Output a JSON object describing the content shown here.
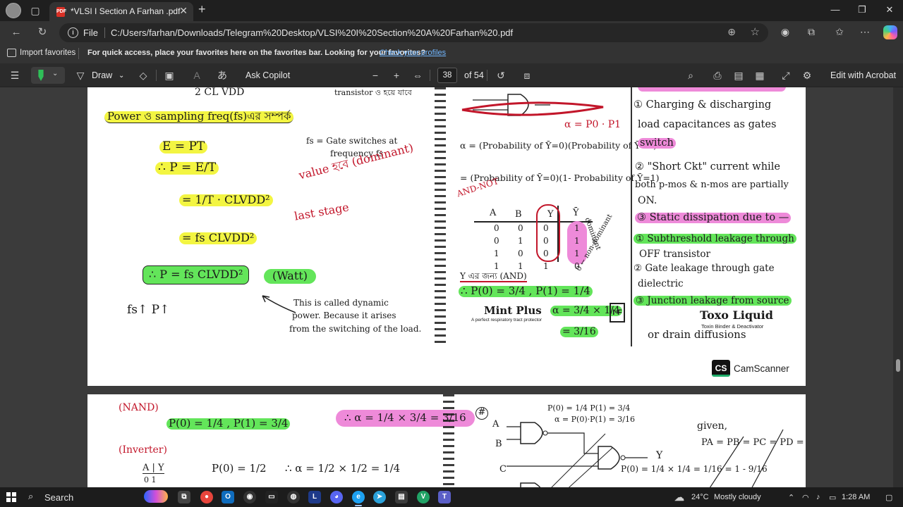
{
  "browser": {
    "tab_title": "*VLSI I Section A Farhan .pdf",
    "file_label": "File",
    "url": "C:/Users/farhan/Downloads/Telegram%20Desktop/VLSI%20I%20Section%20A%20Farhan%20.pdf"
  },
  "favorites_bar": {
    "import_label": "Import favorites",
    "message": "For quick access, place your favorites here on the favorites bar. Looking for your favorites?",
    "link": "Check your profiles"
  },
  "pdf_toolbar": {
    "draw_label": "Draw",
    "ask_copilot_label": "Ask Copilot",
    "current_page": "38",
    "total_pages": "of 54",
    "edit_acrobat_label": "Edit with Acrobat"
  },
  "page1": {
    "left": {
      "cvdd_top": "2 CL VDD",
      "transistor_note": "transistor ও হয়ে যাবে",
      "heading": "Power ও sampling freq(fs)এর সম্পর্ক",
      "eq1": "E = PT",
      "eq2": "∴ P = E/T",
      "eq3": "= 1/T · CLVDD²",
      "eq4": "= fs CLVDD²",
      "eq5": "∴ P = fs CLVDD²",
      "unit": "(Watt)",
      "relation": "fs↑   P↑",
      "fs_note_1": "fs = Gate switches at",
      "fs_note_2": "frequency  fs",
      "value_note": "value হবে (dominant)",
      "last_stage": "last stage",
      "dynamic_1": "This is called dynamic",
      "dynamic_2": "power. Because it arises",
      "dynamic_3": "from the switching of the load."
    },
    "middle": {
      "alpha_def": "α = P0 · P1",
      "alpha_eq1": "α = (Probability of Ȳ=0)(Probability of Ȳ=1)",
      "alpha_eq2": "= (Probability of Ȳ=0)(1- Probability of Ȳ=1)",
      "and_not": "AND-NOT",
      "table_headers": [
        "A",
        "B",
        "Y",
        "Ȳ"
      ],
      "table_rows": [
        [
          "0",
          "0",
          "0",
          "1"
        ],
        [
          "0",
          "1",
          "0",
          "1"
        ],
        [
          "1",
          "0",
          "0",
          "1"
        ],
        [
          "1",
          "1",
          "1",
          "0"
        ]
      ],
      "dominant": "dominant",
      "non_dominant": "0 ← non-dominant",
      "y_note": "Y এর জন্য (AND)",
      "p_vals": "∴ P(0) = 3/4 ,  P(1) = 1/4",
      "alpha_result": "α = 3/4 × 1/4",
      "alpha_final": "= 3/16",
      "mint_brand": "Mint Plus",
      "mint_tag": "A perfect respiratory tract protector"
    },
    "right": {
      "r1": "① Charging & discharging",
      "r2": "load capacitances as gates",
      "r3": "switch",
      "r4": "② \"Short Ckt\" current while",
      "r5": "both p-mos & n-mos are partially",
      "r6": "ON.",
      "r7": "③ Static dissipation due to —",
      "r8": "① Subthreshold leakage through",
      "r9": "OFF transistor",
      "r10": "② Gate leakage through gate",
      "r11": "dielectric",
      "r12": "③ Junction leakage from source",
      "r13": "or drain diffusions",
      "toxo_brand": "Toxo Liquid",
      "toxo_tag": "Toxin Binder & Deactivator"
    },
    "camscanner": {
      "logo": "CS",
      "name": "CamScanner"
    }
  },
  "page2": {
    "nand": "(NAND)",
    "p_eq_1": "P(0) = 1/4 ,  P(1) = 3/4",
    "alpha_eq": "∴ α = 1/4 × 3/4 = 3/16",
    "inverter": "(Inverter)",
    "inv_table": "A | Y",
    "inv_row": "0  1",
    "p_inv": "P(0) = 1/2",
    "alpha_inv": "∴ α = 1/2 × 1/2 = 1/4",
    "circle_num": "#",
    "circuit_note_1": "P(0) = 1/4  P(1) = 3/4",
    "circuit_note_2": "α = P(0)·P(1) = 3/16",
    "labels": [
      "A",
      "B",
      "C",
      "Y"
    ],
    "given": "given,",
    "given_eq": "PA = PB = PC = PD = 0.5",
    "bottom_eq": "P(0) = 1/4 × 1/4 = 1/16 = 1 - 9/16"
  },
  "taskbar": {
    "search_label": "Search",
    "weather": "24°C",
    "weather_desc": "Mostly cloudy",
    "time": "1:28 AM"
  }
}
